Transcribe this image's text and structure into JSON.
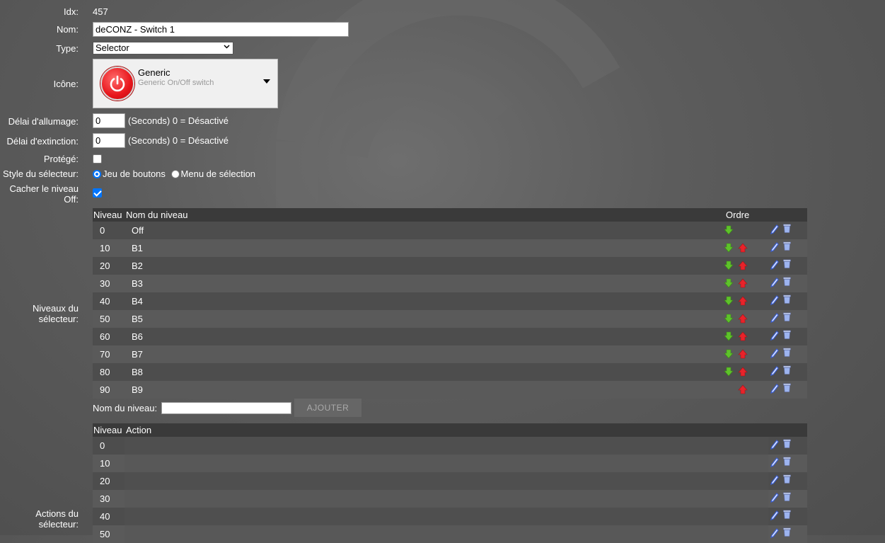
{
  "form": {
    "idx_label": "Idx:",
    "idx_value": "457",
    "name_label": "Nom:",
    "name_value": "deCONZ - Switch 1",
    "type_label": "Type:",
    "type_value": "Selector",
    "icon_label": "Icône:",
    "icon_name": "Generic",
    "icon_desc": "Generic On/Off switch",
    "on_delay_label": "Délai d'allumage:",
    "on_delay_value": "0",
    "on_delay_hint": "(Seconds) 0 = Désactivé",
    "off_delay_label": "Délai d'extinction:",
    "off_delay_value": "0",
    "off_delay_hint": "(Seconds) 0 = Désactivé",
    "protected_label": "Protégé:",
    "protected_checked": false,
    "selector_style_label": "Style du sélecteur:",
    "style_option_buttons": "Jeu de boutons",
    "style_option_menu": "Menu de sélection",
    "hide_off_label_1": "Cacher le niveau",
    "hide_off_label_2": "Off:",
    "hide_off_checked": true
  },
  "levels": {
    "section_label_1": "Niveaux du",
    "section_label_2": "sélecteur:",
    "col_level": "Niveau",
    "col_name": "Nom du niveau",
    "col_order": "Ordre",
    "rows": [
      {
        "level": "0",
        "name": "Off"
      },
      {
        "level": "10",
        "name": "B1"
      },
      {
        "level": "20",
        "name": "B2"
      },
      {
        "level": "30",
        "name": "B3"
      },
      {
        "level": "40",
        "name": "B4"
      },
      {
        "level": "50",
        "name": "B5"
      },
      {
        "level": "60",
        "name": "B6"
      },
      {
        "level": "70",
        "name": "B7"
      },
      {
        "level": "80",
        "name": "B8"
      },
      {
        "level": "90",
        "name": "B9"
      }
    ],
    "add_label": "Nom du niveau:",
    "add_value": "",
    "add_button": "AJOUTER"
  },
  "actions": {
    "section_label_1": "Actions du",
    "section_label_2": "sélecteur:",
    "col_level": "Niveau",
    "col_action": "Action",
    "rows": [
      {
        "level": "0"
      },
      {
        "level": "10"
      },
      {
        "level": "20"
      },
      {
        "level": "30"
      },
      {
        "level": "40"
      },
      {
        "level": "50"
      }
    ]
  },
  "colors": {
    "arrow_down": "#5ec22a",
    "arrow_up": "#e8232a",
    "edit": "#3b5fd6",
    "checkbox_accent": "#0075ff"
  }
}
